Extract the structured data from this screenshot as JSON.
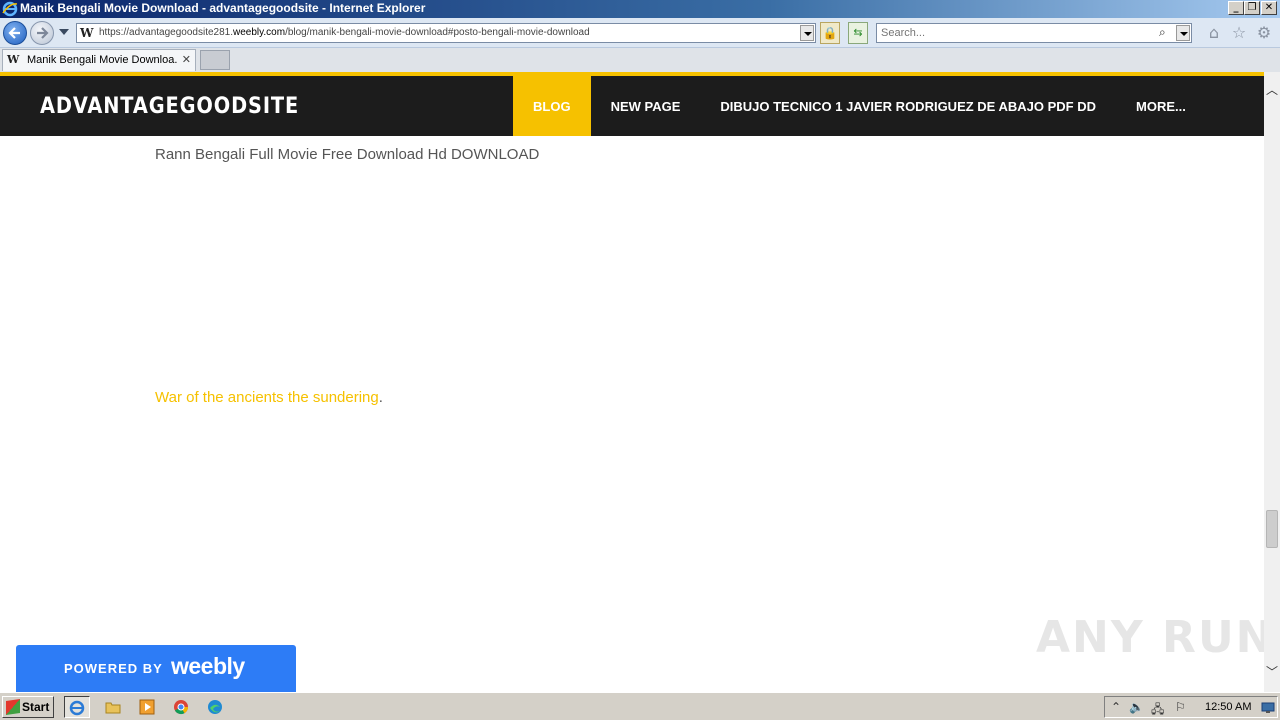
{
  "window": {
    "title": "Manik Bengali Movie Download - advantagegoodsite - Internet Explorer",
    "min_label": "_",
    "max_label": "❐",
    "close_label": "✕"
  },
  "addressbar": {
    "url_prefix": "https://advantagegoodsite281.",
    "url_domain": "weebly.com",
    "url_path": "/blog/manik-bengali-movie-download#posto-bengali-movie-download",
    "search_placeholder": "Search..."
  },
  "tabs": [
    {
      "label": "Manik Bengali Movie Downloa...",
      "close": "✕"
    }
  ],
  "site": {
    "logo": "ADVANTAGEGOODSITE",
    "nav": [
      {
        "label": "BLOG",
        "active": true
      },
      {
        "label": "NEW PAGE",
        "active": false
      },
      {
        "label": "DIBUJO TECNICO 1 JAVIER RODRIGUEZ DE ABAJO PDF DD",
        "active": false
      },
      {
        "label": "MORE...",
        "active": false
      }
    ],
    "accent_color": "#f6c100"
  },
  "content": {
    "line1": "Rann Bengali Full Movie Free Download Hd DOWNLOAD",
    "link_text": "War of the ancients the sundering",
    "link_suffix": "."
  },
  "badge": {
    "powered_by": "POWERED BY",
    "brand": "weebly"
  },
  "watermark": "ANY RUN",
  "taskbar": {
    "start_label": "Start",
    "clock": "12:50 AM"
  }
}
